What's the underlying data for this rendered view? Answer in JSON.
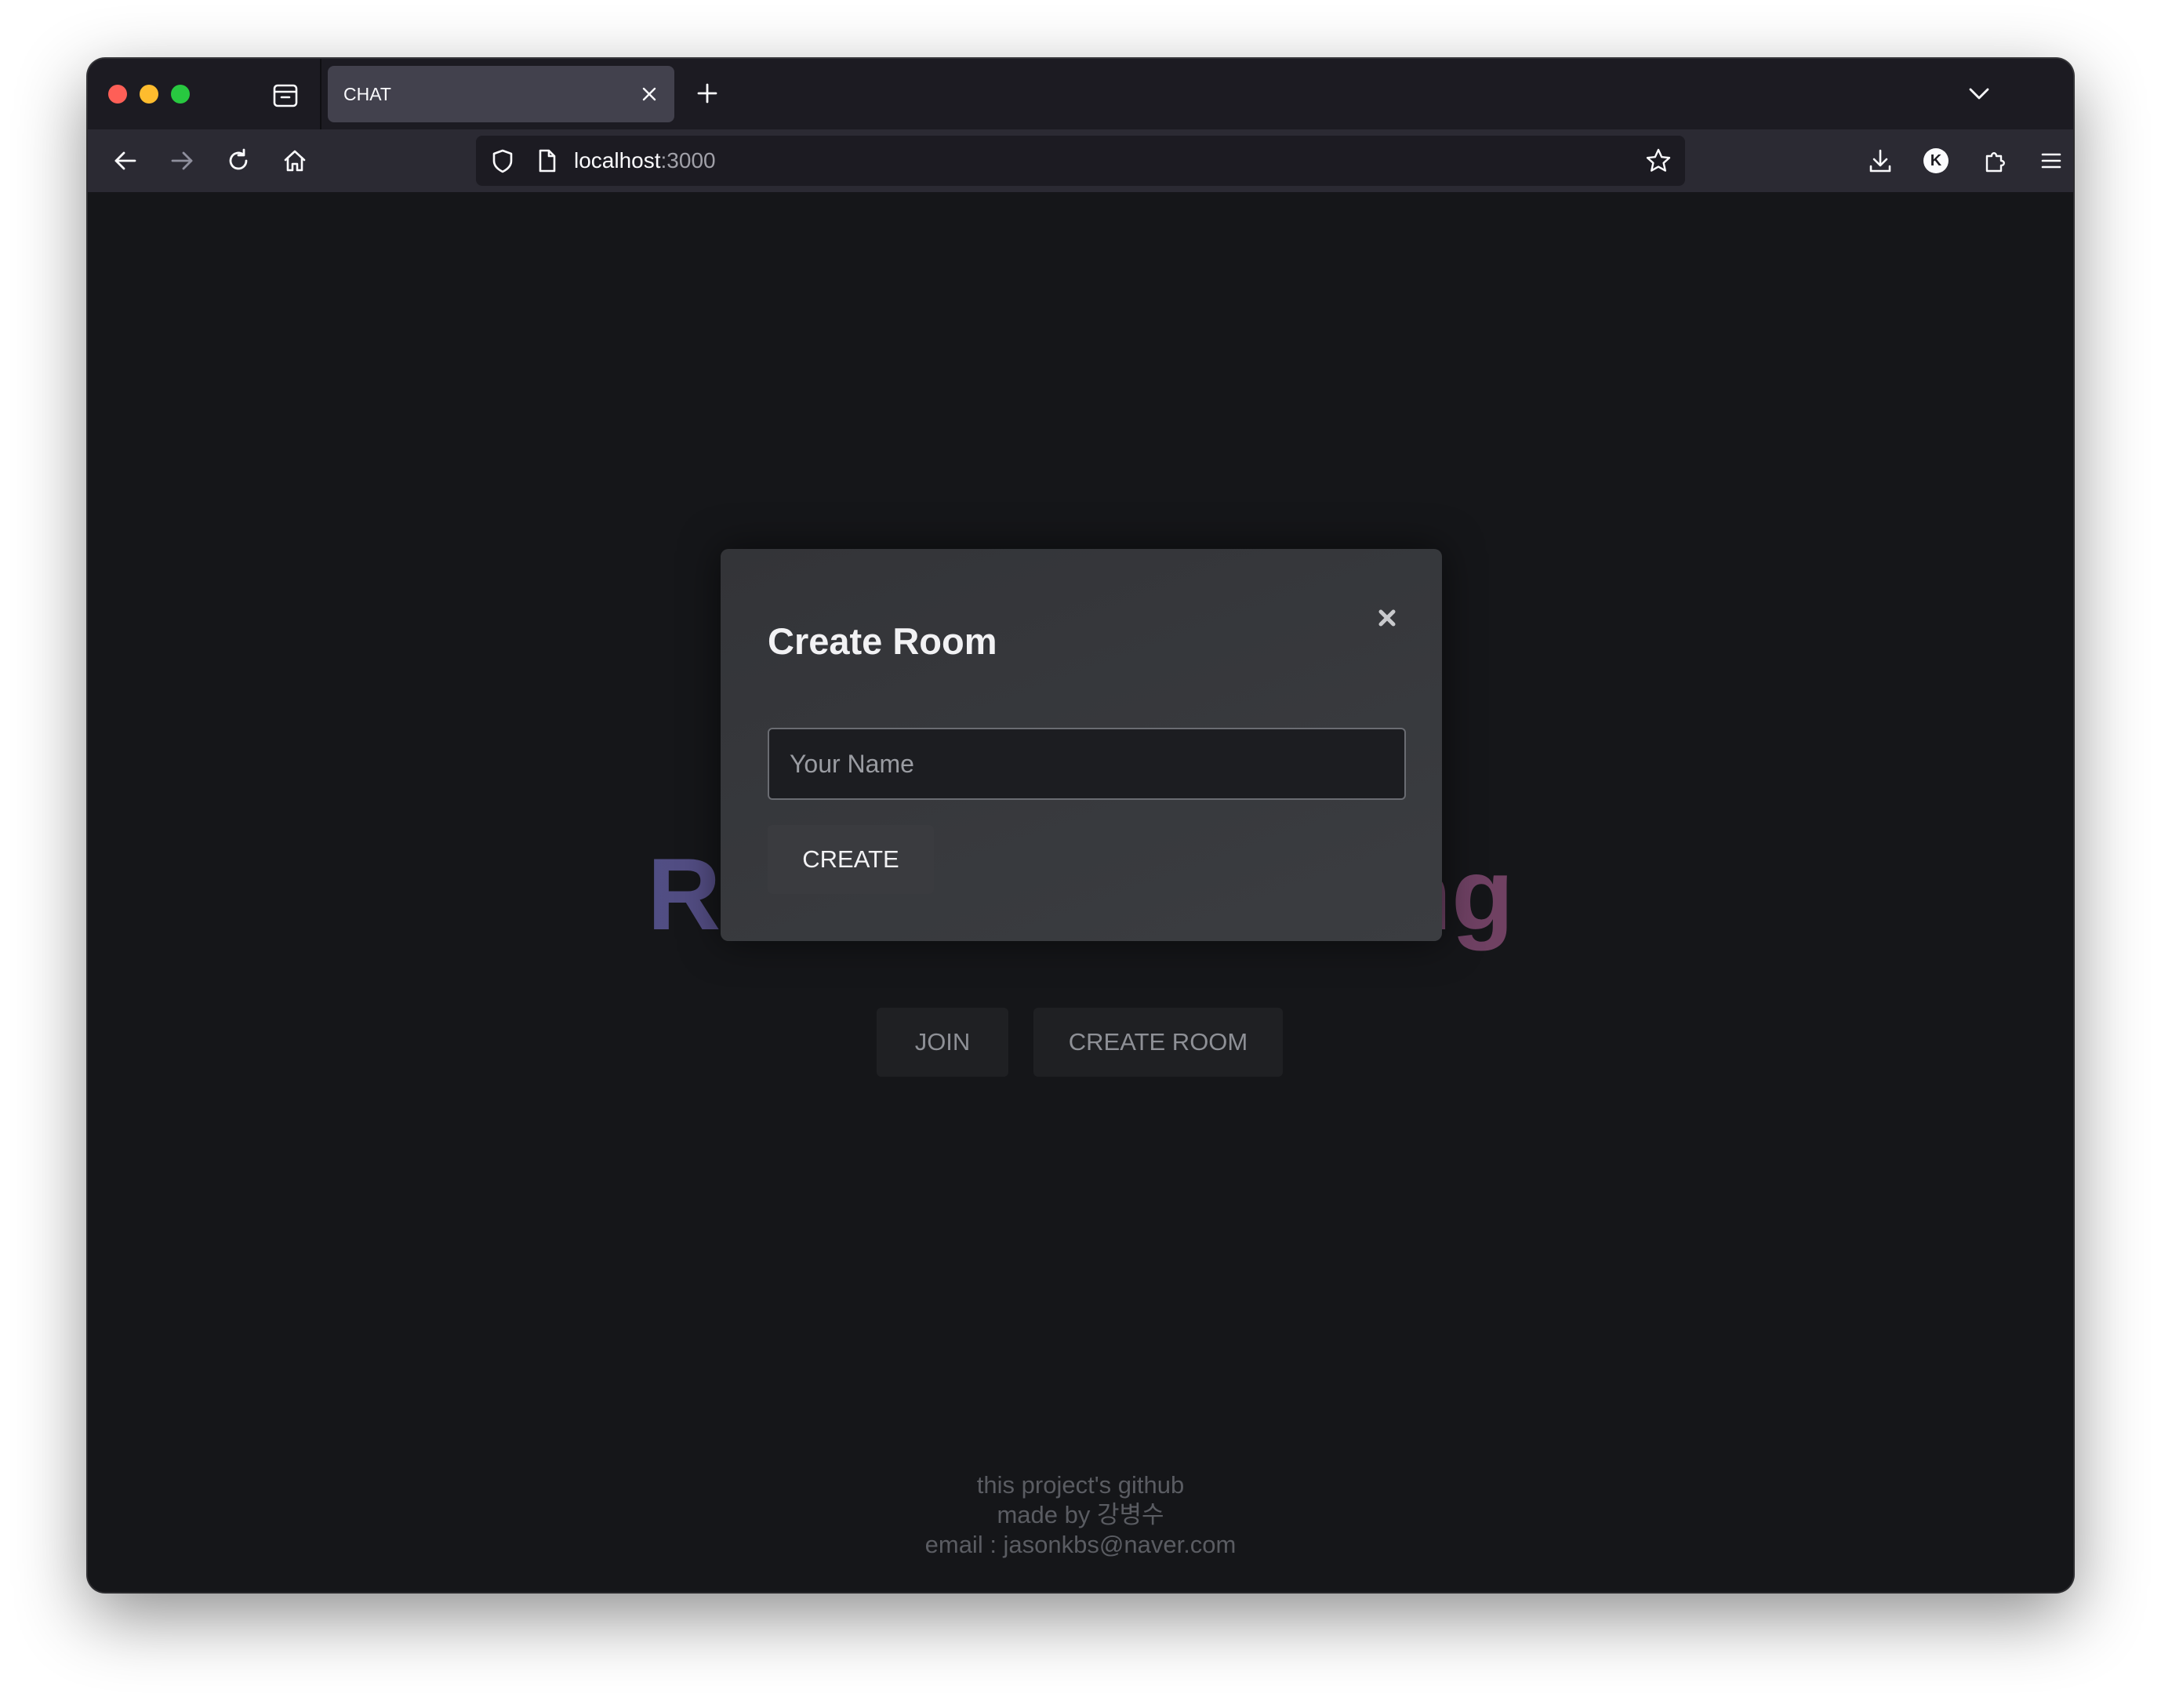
{
  "browser": {
    "tab_title": "CHAT",
    "url_host": "localhost",
    "url_port": ":3000",
    "profile_initial": "K"
  },
  "page": {
    "hero_title": "Realtime Chatting",
    "join_label": "JOIN",
    "create_room_label": "CREATE ROOM",
    "footer": {
      "github": "this project's github",
      "made_by": "made by 강병수",
      "email": "email : jasonkbs@naver.com"
    }
  },
  "modal": {
    "title": "Create Room",
    "name_placeholder": "Your Name",
    "name_value": "",
    "create_label": "CREATE"
  },
  "colors": {
    "page_background": "#151619",
    "modal_background": "#37383c",
    "title_gradient_start": "#3b5ea8",
    "title_gradient_end": "#8a3e52"
  }
}
